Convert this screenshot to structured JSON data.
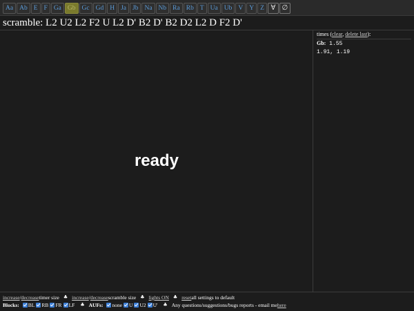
{
  "case_buttons": [
    "Aa",
    "Ab",
    "E",
    "F",
    "Ga",
    "Gb",
    "Gc",
    "Gd",
    "H",
    "Ja",
    "Jb",
    "Na",
    "Nb",
    "Ra",
    "Rb",
    "T",
    "Ua",
    "Ub",
    "V",
    "Y",
    "Z"
  ],
  "selected_case": "Gb",
  "tools": {
    "select_all": "∀",
    "select_none": "∅"
  },
  "scramble": "scramble: L2 U2 L2 F2 U L2 D' B2 D' B2 D2 L2 D F2 D'",
  "timer": {
    "text": "ready"
  },
  "times": {
    "label_prefix": "times (",
    "clear": "clear",
    "separator": ", ",
    "delete_last": "delete last",
    "label_suffix": "):",
    "rows": [
      {
        "case": "Gb:",
        "values": " 1.55"
      },
      {
        "case": "",
        "values": "1.91, 1.19"
      }
    ]
  },
  "footer": {
    "increase": "increase",
    "slash": "/",
    "decrease": "decrease",
    "timer_size": " timer size",
    "increase2": "increase",
    "slash2": "/",
    "decrease2": "decrease",
    "scramble_size": " scramble size",
    "lights": "lights ON",
    "reset": "reset",
    "reset_rest": " all settings to default",
    "club": "♣",
    "blocks_label": "Blocks:",
    "blocks": [
      "BL",
      "RB",
      "FR",
      "LF"
    ],
    "aufs_label": "AUFs:",
    "aufs": [
      "none",
      "U",
      "U2",
      "U'"
    ],
    "contact_text": "Any questions/suggestions/bugs reports - email me ",
    "contact_link": "here"
  },
  "colors": {
    "background": "#1c1c1c",
    "link_blue": "#5b9bd9",
    "selected_case_bg": "#7a7a2c",
    "checkbox_blue": "#3d7fd6"
  }
}
